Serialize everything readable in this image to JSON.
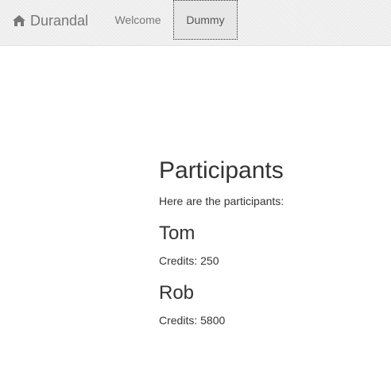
{
  "navbar": {
    "brand": {
      "icon": "home-icon",
      "label": "Durandal"
    },
    "items": [
      {
        "label": "Welcome",
        "active": false
      },
      {
        "label": "Dummy",
        "active": true
      }
    ]
  },
  "main": {
    "title": "Participants",
    "intro": "Here are the participants:",
    "participants": [
      {
        "name": "Tom",
        "credits": "Credits: 250"
      },
      {
        "name": "Rob",
        "credits": "Credits: 5800"
      }
    ]
  }
}
